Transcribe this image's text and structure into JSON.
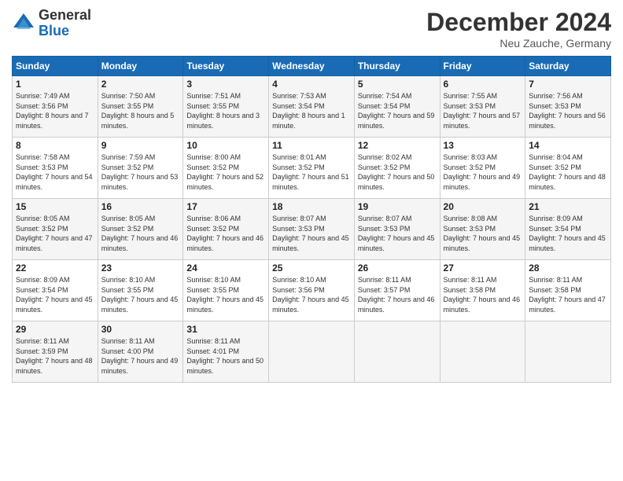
{
  "logo": {
    "general": "General",
    "blue": "Blue"
  },
  "header": {
    "title": "December 2024",
    "location": "Neu Zauche, Germany"
  },
  "columns": [
    "Sunday",
    "Monday",
    "Tuesday",
    "Wednesday",
    "Thursday",
    "Friday",
    "Saturday"
  ],
  "weeks": [
    [
      {
        "day": "1",
        "sunrise": "7:49 AM",
        "sunset": "3:56 PM",
        "daylight": "8 hours and 7 minutes."
      },
      {
        "day": "2",
        "sunrise": "7:50 AM",
        "sunset": "3:55 PM",
        "daylight": "8 hours and 5 minutes."
      },
      {
        "day": "3",
        "sunrise": "7:51 AM",
        "sunset": "3:55 PM",
        "daylight": "8 hours and 3 minutes."
      },
      {
        "day": "4",
        "sunrise": "7:53 AM",
        "sunset": "3:54 PM",
        "daylight": "8 hours and 1 minute."
      },
      {
        "day": "5",
        "sunrise": "7:54 AM",
        "sunset": "3:54 PM",
        "daylight": "7 hours and 59 minutes."
      },
      {
        "day": "6",
        "sunrise": "7:55 AM",
        "sunset": "3:53 PM",
        "daylight": "7 hours and 57 minutes."
      },
      {
        "day": "7",
        "sunrise": "7:56 AM",
        "sunset": "3:53 PM",
        "daylight": "7 hours and 56 minutes."
      }
    ],
    [
      {
        "day": "8",
        "sunrise": "7:58 AM",
        "sunset": "3:53 PM",
        "daylight": "7 hours and 54 minutes."
      },
      {
        "day": "9",
        "sunrise": "7:59 AM",
        "sunset": "3:52 PM",
        "daylight": "7 hours and 53 minutes."
      },
      {
        "day": "10",
        "sunrise": "8:00 AM",
        "sunset": "3:52 PM",
        "daylight": "7 hours and 52 minutes."
      },
      {
        "day": "11",
        "sunrise": "8:01 AM",
        "sunset": "3:52 PM",
        "daylight": "7 hours and 51 minutes."
      },
      {
        "day": "12",
        "sunrise": "8:02 AM",
        "sunset": "3:52 PM",
        "daylight": "7 hours and 50 minutes."
      },
      {
        "day": "13",
        "sunrise": "8:03 AM",
        "sunset": "3:52 PM",
        "daylight": "7 hours and 49 minutes."
      },
      {
        "day": "14",
        "sunrise": "8:04 AM",
        "sunset": "3:52 PM",
        "daylight": "7 hours and 48 minutes."
      }
    ],
    [
      {
        "day": "15",
        "sunrise": "8:05 AM",
        "sunset": "3:52 PM",
        "daylight": "7 hours and 47 minutes."
      },
      {
        "day": "16",
        "sunrise": "8:05 AM",
        "sunset": "3:52 PM",
        "daylight": "7 hours and 46 minutes."
      },
      {
        "day": "17",
        "sunrise": "8:06 AM",
        "sunset": "3:52 PM",
        "daylight": "7 hours and 46 minutes."
      },
      {
        "day": "18",
        "sunrise": "8:07 AM",
        "sunset": "3:53 PM",
        "daylight": "7 hours and 45 minutes."
      },
      {
        "day": "19",
        "sunrise": "8:07 AM",
        "sunset": "3:53 PM",
        "daylight": "7 hours and 45 minutes."
      },
      {
        "day": "20",
        "sunrise": "8:08 AM",
        "sunset": "3:53 PM",
        "daylight": "7 hours and 45 minutes."
      },
      {
        "day": "21",
        "sunrise": "8:09 AM",
        "sunset": "3:54 PM",
        "daylight": "7 hours and 45 minutes."
      }
    ],
    [
      {
        "day": "22",
        "sunrise": "8:09 AM",
        "sunset": "3:54 PM",
        "daylight": "7 hours and 45 minutes."
      },
      {
        "day": "23",
        "sunrise": "8:10 AM",
        "sunset": "3:55 PM",
        "daylight": "7 hours and 45 minutes."
      },
      {
        "day": "24",
        "sunrise": "8:10 AM",
        "sunset": "3:55 PM",
        "daylight": "7 hours and 45 minutes."
      },
      {
        "day": "25",
        "sunrise": "8:10 AM",
        "sunset": "3:56 PM",
        "daylight": "7 hours and 45 minutes."
      },
      {
        "day": "26",
        "sunrise": "8:11 AM",
        "sunset": "3:57 PM",
        "daylight": "7 hours and 46 minutes."
      },
      {
        "day": "27",
        "sunrise": "8:11 AM",
        "sunset": "3:58 PM",
        "daylight": "7 hours and 46 minutes."
      },
      {
        "day": "28",
        "sunrise": "8:11 AM",
        "sunset": "3:58 PM",
        "daylight": "7 hours and 47 minutes."
      }
    ],
    [
      {
        "day": "29",
        "sunrise": "8:11 AM",
        "sunset": "3:59 PM",
        "daylight": "7 hours and 48 minutes."
      },
      {
        "day": "30",
        "sunrise": "8:11 AM",
        "sunset": "4:00 PM",
        "daylight": "7 hours and 49 minutes."
      },
      {
        "day": "31",
        "sunrise": "8:11 AM",
        "sunset": "4:01 PM",
        "daylight": "7 hours and 50 minutes."
      },
      null,
      null,
      null,
      null
    ]
  ]
}
